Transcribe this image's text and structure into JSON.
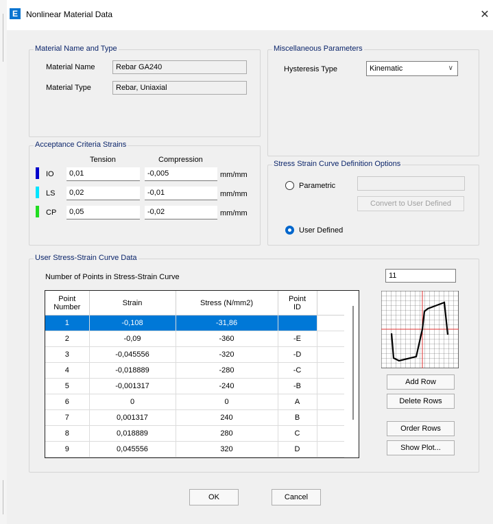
{
  "window": {
    "title": "Nonlinear Material Data",
    "app_icon_letter": "E"
  },
  "material": {
    "group_title": "Material Name and Type",
    "name_label": "Material Name",
    "name_value": "Rebar GA240",
    "type_label": "Material Type",
    "type_value": "Rebar, Uniaxial"
  },
  "misc": {
    "group_title": "Miscellaneous Parameters",
    "hysteresis_label": "Hysteresis Type",
    "hysteresis_value": "Kinematic"
  },
  "acceptance": {
    "group_title": "Acceptance Criteria Strains",
    "tension_header": "Tension",
    "compression_header": "Compression",
    "rows": [
      {
        "label": "IO",
        "color": "#0000cc",
        "tension": "0,01",
        "compression": "-0,005",
        "unit": "mm/mm"
      },
      {
        "label": "LS",
        "color": "#00e5ff",
        "tension": "0,02",
        "compression": "-0,01",
        "unit": "mm/mm"
      },
      {
        "label": "CP",
        "color": "#22dd22",
        "tension": "0,05",
        "compression": "-0,02",
        "unit": "mm/mm"
      }
    ]
  },
  "curve_options": {
    "group_title": "Stress Strain Curve Definition Options",
    "parametric_label": "Parametric",
    "parametric_selected": false,
    "parametric_value": "",
    "convert_button": "Convert to User Defined",
    "user_defined_label": "User Defined",
    "user_defined_selected": true
  },
  "curve_data": {
    "group_title": "User Stress-Strain Curve Data",
    "num_points_label": "Number of Points in Stress-Strain Curve",
    "num_points_value": "11",
    "columns": [
      "Point\nNumber",
      "Strain",
      "Stress  (N/mm2)",
      "Point\nID"
    ],
    "rows": [
      {
        "num": "1",
        "strain": "-0,108",
        "stress": "-31,86",
        "id": ""
      },
      {
        "num": "2",
        "strain": "-0,09",
        "stress": "-360",
        "id": "-E"
      },
      {
        "num": "3",
        "strain": "-0,045556",
        "stress": "-320",
        "id": "-D"
      },
      {
        "num": "4",
        "strain": "-0,018889",
        "stress": "-280",
        "id": "-C"
      },
      {
        "num": "5",
        "strain": "-0,001317",
        "stress": "-240",
        "id": "-B"
      },
      {
        "num": "6",
        "strain": "0",
        "stress": "0",
        "id": "A"
      },
      {
        "num": "7",
        "strain": "0,001317",
        "stress": "240",
        "id": "B"
      },
      {
        "num": "8",
        "strain": "0,018889",
        "stress": "280",
        "id": "C"
      },
      {
        "num": "9",
        "strain": "0,045556",
        "stress": "320",
        "id": "D"
      }
    ],
    "selected_row": 0,
    "buttons": {
      "add_row": "Add Row",
      "delete_rows": "Delete Rows",
      "order_rows": "Order Rows",
      "show_plot": "Show Plot..."
    }
  },
  "footer": {
    "ok": "OK",
    "cancel": "Cancel"
  }
}
